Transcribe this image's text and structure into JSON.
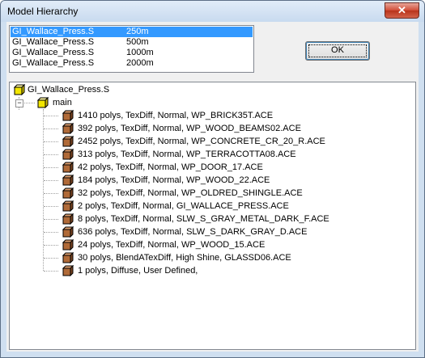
{
  "window": {
    "title": "Model Hierarchy",
    "close_glyph": "✕"
  },
  "lod_list": [
    {
      "name": "GI_Wallace_Press.S",
      "distance": "250m",
      "selected": true
    },
    {
      "name": "GI_Wallace_Press.S",
      "distance": "500m",
      "selected": false
    },
    {
      "name": "GI_Wallace_Press.S",
      "distance": "1000m",
      "selected": false
    },
    {
      "name": "GI_Wallace_Press.S",
      "distance": "2000m",
      "selected": false
    }
  ],
  "ok_button": {
    "label": "OK"
  },
  "tree": {
    "root": {
      "label": "GI_Wallace_Press.S",
      "icon": "yellow-cube-icon"
    },
    "group": {
      "label": "main",
      "icon": "yellow-cube-icon",
      "expander": "−"
    },
    "items": [
      {
        "label": "1410 polys, TexDiff, Normal, WP_BRICK35T.ACE",
        "icon": "brown-cube-icon"
      },
      {
        "label": "392 polys, TexDiff, Normal, WP_WOOD_BEAMS02.ACE",
        "icon": "brown-cube-icon"
      },
      {
        "label": "2452 polys, TexDiff, Normal, WP_CONCRETE_CR_20_R.ACE",
        "icon": "brown-cube-icon"
      },
      {
        "label": "313 polys, TexDiff, Normal, WP_TERRACOTTA08.ACE",
        "icon": "brown-cube-icon"
      },
      {
        "label": "42 polys, TexDiff, Normal, WP_DOOR_17.ACE",
        "icon": "brown-cube-icon"
      },
      {
        "label": "184 polys, TexDiff, Normal, WP_WOOD_22.ACE",
        "icon": "brown-cube-icon"
      },
      {
        "label": "32 polys, TexDiff, Normal, WP_OLDRED_SHINGLE.ACE",
        "icon": "brown-cube-icon"
      },
      {
        "label": "2 polys, TexDiff, Normal, GI_WALLACE_PRESS.ACE",
        "icon": "brown-cube-icon"
      },
      {
        "label": "8 polys, TexDiff, Normal, SLW_S_GRAY_METAL_DARK_F.ACE",
        "icon": "brown-cube-icon"
      },
      {
        "label": "636 polys, TexDiff, Normal, SLW_S_DARK_GRAY_D.ACE",
        "icon": "brown-cube-icon"
      },
      {
        "label": "24 polys, TexDiff, Normal, WP_WOOD_15.ACE",
        "icon": "brown-cube-icon"
      },
      {
        "label": "30 polys, BlendATexDiff, High Shine, GLASSD06.ACE",
        "icon": "brown-cube-icon"
      },
      {
        "label": "1 polys, Diffuse, User Defined,",
        "icon": "brown-cube-icon"
      }
    ]
  },
  "colors": {
    "selection": "#3399ff",
    "yellow_cube": "#f2e600",
    "brown_cube": "#b06a38"
  }
}
